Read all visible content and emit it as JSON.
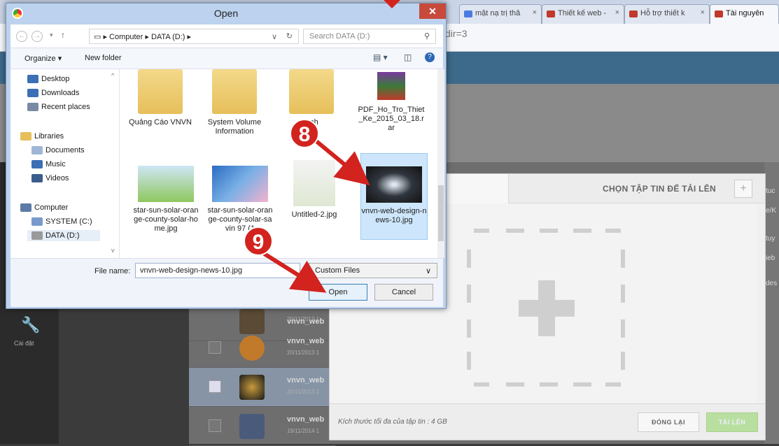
{
  "browser": {
    "tabs": [
      {
        "label": "mặt nạ trị thâ",
        "color": "#4c7be3"
      },
      {
        "label": "Thiết kế web -",
        "color": "#c0392b"
      },
      {
        "label": "Hỗ trợ thiết k",
        "color": "#c0392b"
      },
      {
        "label": "Tài nguyên",
        "color": "#c0392b"
      }
    ],
    "url_fragment": "dir=3"
  },
  "background": {
    "sidebar_setting_label": "Cài đặt",
    "rows": [
      {
        "name": "vnvn_web",
        "date": "20/11/2013 1"
      },
      {
        "name": "vnvn_web",
        "date": "20/11/2013 1"
      },
      {
        "name": "vnvn_web",
        "date": "20/11/2013 1"
      },
      {
        "name": "vnvn_web",
        "date": "19/11/2014 1"
      }
    ],
    "right_texts": [
      "tuc",
      "e/K",
      "tuy",
      "ieb",
      "des"
    ]
  },
  "upload_panel": {
    "tab_label": "TẢI LÊN",
    "title": "CHỌN TẬP TIN ĐỂ TẢI LÊN",
    "plus_symbol": "+",
    "max_size_text": "Kích thước tối đa của tập tin : 4 GB",
    "reset_label": "ĐÓNG LẠI",
    "upload_label": "TẢI LÊN"
  },
  "dialog": {
    "title": "Open",
    "close_symbol": "✕",
    "path": [
      "Computer",
      "DATA (D:)"
    ],
    "search_placeholder": "Search DATA (D:)",
    "organize_label": "Organize ▾",
    "new_folder_label": "New folder",
    "nav_items": [
      {
        "label": "Desktop",
        "color": "#3b6fb6"
      },
      {
        "label": "Downloads",
        "color": "#3b6fb6"
      },
      {
        "label": "Recent places",
        "color": "#7a8aa6"
      },
      {
        "label": "Libraries",
        "color": "#e6bf5a"
      },
      {
        "label": "Documents",
        "color": "#9fb6d6"
      },
      {
        "label": "Music",
        "color": "#3b6fb6"
      },
      {
        "label": "Videos",
        "color": "#3b5d8c"
      },
      {
        "label": "Computer",
        "color": "#5b7ba6"
      },
      {
        "label": "SYSTEM (C:)",
        "color": "#7a9acb"
      },
      {
        "label": "DATA (D:)",
        "color": "#9a9a9a"
      }
    ],
    "files": [
      {
        "label": "Quảng Cáo VNVN",
        "kind": "folder"
      },
      {
        "label": "System Volume Information",
        "kind": "folder"
      },
      {
        "label": "Anh",
        "kind": "folder"
      },
      {
        "label": "PDF_Ho_Tro_Thiet_Ke_2015_03_18.rar",
        "kind": "rar"
      },
      {
        "label": "star-sun-solar-orange-county-solar-home.jpg",
        "kind": "image"
      },
      {
        "label": "star-sun-solar-orange-county-solar-savin 97 (1",
        "kind": "image"
      },
      {
        "label": "Untitled-2.jpg",
        "kind": "image"
      },
      {
        "label": "vnvn-web-design-news-10.jpg",
        "kind": "image"
      }
    ],
    "file_name_label": "File name:",
    "file_name_value": "vnvn-web-design-news-10.jpg",
    "filter_value": "Custom Files",
    "open_label": "Open",
    "cancel_label": "Cancel"
  },
  "annotations": {
    "step8": "8",
    "step9": "9",
    "color": "#d2231f"
  }
}
